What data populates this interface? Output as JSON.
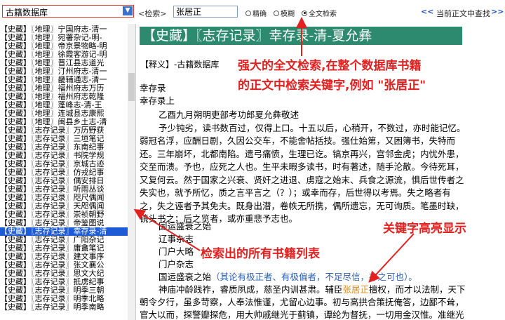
{
  "toolbar": {
    "db_select": "古籍数据库",
    "search_label": "<检索>",
    "search_value": "张居正",
    "radio_exact": "精确",
    "radio_fuzzy": "模糊",
    "radio_full": "全文检索",
    "nav_prev": "<<",
    "nav_label": "当前正文中查找",
    "nav_next": ">>"
  },
  "list": [
    "【史藏】〖地理〗宁国府志-清一",
    "【史藏】〖地理〗宛署杂记-明-",
    "【史藏】〖地理〗帝京景物略-明",
    "【史藏】〖地理〗徐霞客游记-明",
    "【史藏】〖地理〗晋江县志道光",
    "【史藏】〖地理〗汀州府志-清一",
    "【史藏】〖地理〗畿辅通志-清一",
    "【史藏】〖地理〗福州府志万历",
    "【史藏】〖地理〗福州府志乾隆",
    "【史藏】〖地理〗蓬峰志-清-王",
    "【史藏】〖地理〗连城县志康熙",
    "【史藏】〖地理〗闽县乡土志-清",
    "【史藏】〖志存记录〗万历野获",
    "【史藏】〖志存记录〗三垣笔记",
    "【史藏】〖志存记录〗东南纪事",
    "【史藏】〖志存记录〗书院学规",
    "【史藏】〖志存记录〗京城古迹",
    "【史藏】〖志存记录〗仿戎纪事",
    "【史藏】〖志存记录〗偶安排日",
    "【史藏】〖志存记录〗听雨丛谈",
    "【史藏】〖志存记录〗咫尺偶闻",
    "【史藏】〖志存记录〗天咫偶闻",
    "【史藏】〖志存记录〗崇祯朝野",
    "【史藏】〖志存记录〗帝鉴图说",
    "【史藏】〖志存记录〗幸存录-清",
    "【史藏】〖志存记录〗广阳杂记",
    "【史藏】〖志存记录〗庸盦笔记",
    "【史藏】〖志存记录〗建文事序",
    "【史藏】〖志存记录〗张文襄公",
    "【史藏】〖志存记录〗思文大纪",
    "【史藏】〖志存记录〗抵虏纪事",
    "【史藏】〖志存记录〗明季三朝",
    "【史藏】〖志存记录〗明季北略",
    "【史藏】〖志存记录〗明季南略"
  ],
  "selected_index": 24,
  "content": {
    "title": "【史藏】〖志存记录〗幸存录-清-夏允彝",
    "note": "【释义】-古籍数据库",
    "heading1": "幸存录",
    "heading2": "幸存录上",
    "lines": [
      "乙酉九月朔明吏部考功郎夏允彝敬述",
      "予少钝劣，读书数百过，仅得上口。十五以后，心稍开，不数过，亦时能记忆。",
      "弱冠名浮，应酬日剧，久因公交车，不能舍帖括技。强仕始第，又困簿书，失特而",
      "还。三年崩坏，北都南陷。遗弓痛愤，生理已讫。镐京再兴，宫邻金虎；内忧外患，",
      "交至而溃。予也，应死之人也。生平未暇多读书，时有著述，随手沦散。今待死耳，",
      "又复何云。然于国家之兴衰、贤奸之进退、虏寇之始末、兵食之源流，惧后世传者之",
      "失实也，就予所忆，质之言平言之（？）；或幸而存，后世得以考焉。失之略者有",
      "之，失之诬者予其免夫。既身出潜，卷帙无所携，偶所遗忘，无可询质。笔墨时缺，",
      "镜头书之；后之览者，或亦重悲予志也。"
    ],
    "toc": [
      "国运盛衰之始",
      "辽事杂志",
      "门户大略",
      "门户杂志"
    ],
    "toc_last": "国运盛衰之始",
    "toc_last_note": "（其论有极正者、有极偏者，不足尽信，存之可也）。",
    "line_a_pre": "神庙冲龄践祚，睿质夙成，慈圣内训甚肃。辅臣",
    "line_a_hl": "张居正",
    "line_a_post": "擅权，而才以法制，天下",
    "line_b": "朝令夕行，虽多苛察，人奉法惟谨，尤留心边事。初与高拱合策抚俺答，边鄙不耸，",
    "line_c": "官大以而，探警瓣探危，用大帅戚继光于蓟镇，谭纶为督抚，一切用金汉惟。准继光"
  },
  "annotations": {
    "search_1": "强大的全文检索,在整个数据库书籍",
    "search_2": "的正文中检索关键字,例如 \"张居正\"",
    "highlight": "关键字高亮显示",
    "list": "检索出的所有书籍列表"
  },
  "colors": {
    "title_bg": "#2e8a6f",
    "highlight": "#e38b1a",
    "annotation": "#e32020",
    "selection": "#1e5bd6"
  }
}
